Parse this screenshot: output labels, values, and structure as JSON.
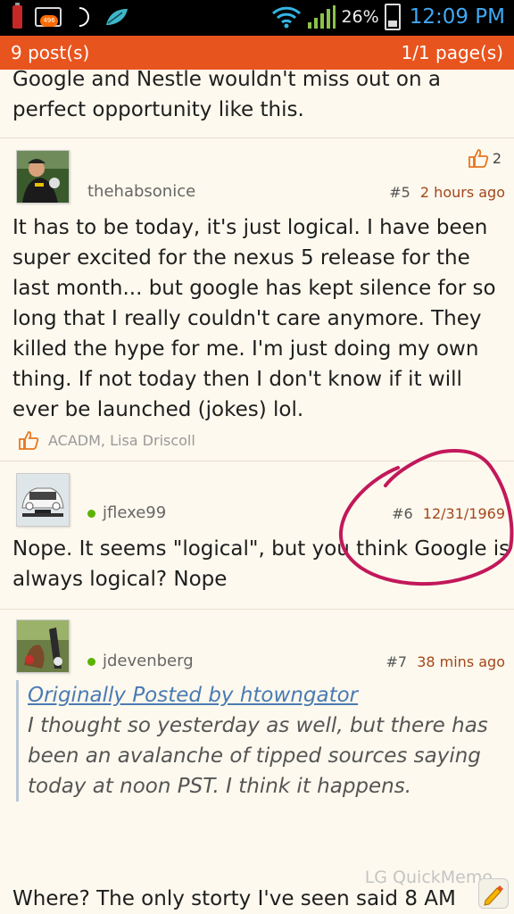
{
  "status_bar": {
    "mail_badge": "496",
    "battery_percent": "26%",
    "time": "12:09 PM"
  },
  "header": {
    "post_count": "9 post(s)",
    "page_info": "1/1 page(s)"
  },
  "prev_post": {
    "tail_text": "Google and Nestle wouldn't miss out on a perfect opportunity like this."
  },
  "posts": [
    {
      "username": "thehabsonice",
      "number": "#5",
      "time": "2 hours ago",
      "likes": "2",
      "body": "It has to be today, it's just logical. I have been super excited for the nexus 5 release for the last month... but google has kept silence for so long that I really couldn't care anymore. They killed the hype for me. I'm just doing my own thing. If not today then I don't know if it will ever be launched (jokes) lol.",
      "thanked_by": "ACADM, Lisa Driscoll"
    },
    {
      "username": "jflexe99",
      "number": "#6",
      "time": "12/31/1969",
      "body": "Nope. It seems \"logical\", but you think Google is always logical? Nope"
    },
    {
      "username": "jdevenberg",
      "number": "#7",
      "time": "38 mins ago",
      "quote_header": "Originally Posted by htowngator",
      "quote_body": "I thought so yesterday as well, but there has been an avalanche of tipped sources saying today at noon PST. I think it happens.",
      "body_start": "Where? The only storty I've seen said 8 AM"
    }
  ],
  "overlay": {
    "quickmemo_label": "LG QuickMemo",
    "annotation_color": "#c2185b"
  },
  "colors": {
    "accent": "#e8541e",
    "time_blue": "#3fa9f5",
    "date_color": "#a3461a",
    "online": "#5bb300"
  }
}
